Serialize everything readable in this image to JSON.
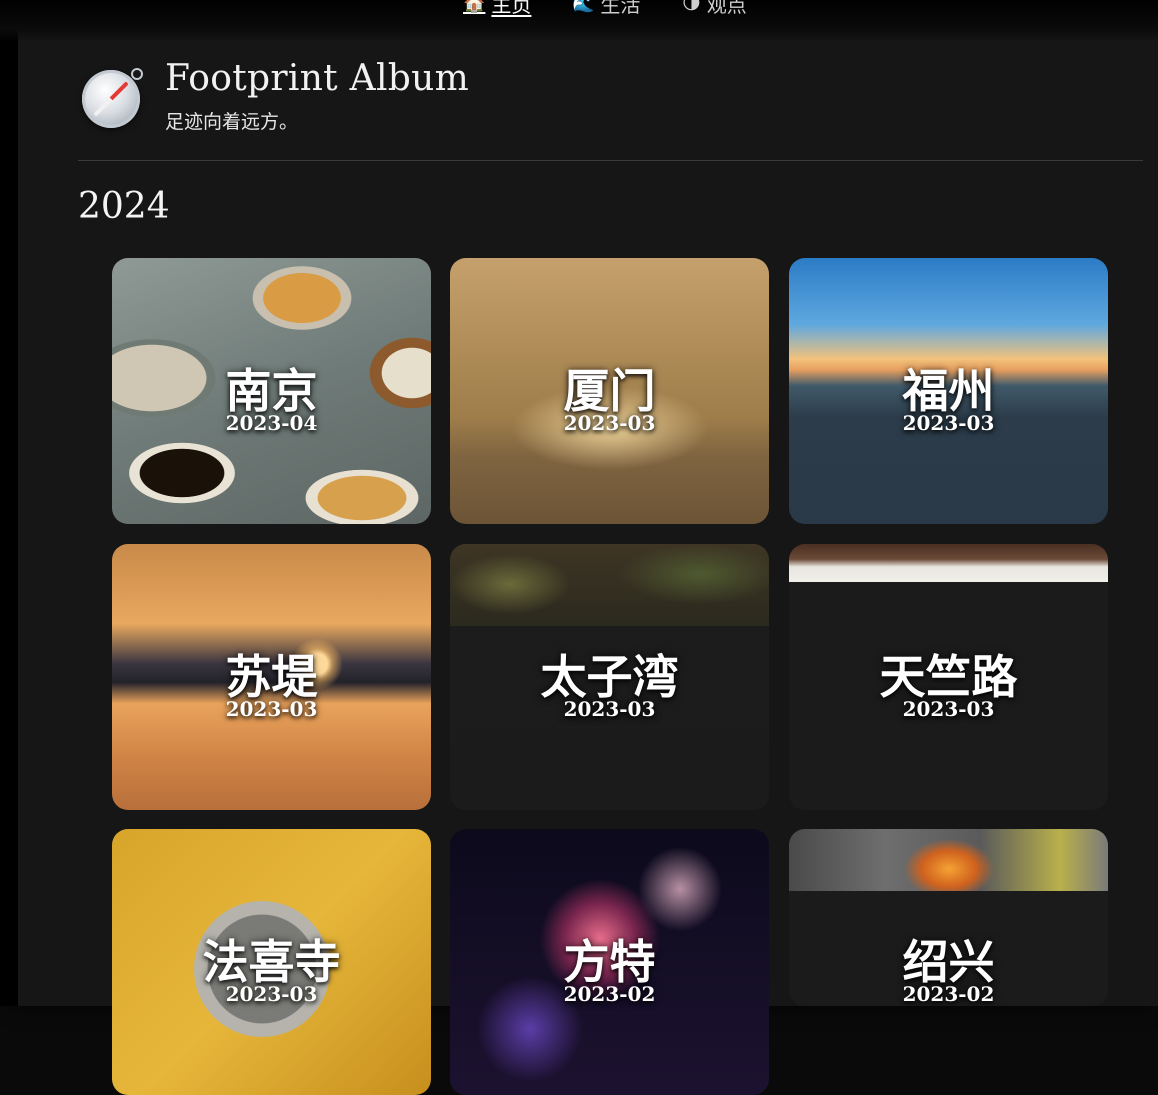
{
  "nav": {
    "items": [
      {
        "icon": "🏠",
        "label": "主页",
        "active": true
      },
      {
        "icon": "🌊",
        "label": "生活",
        "active": false
      },
      {
        "icon": "🌗",
        "label": "观点",
        "active": false
      }
    ]
  },
  "header": {
    "icon": "compass-icon",
    "title": "Footprint Album",
    "subtitle": "足迹向着远方。"
  },
  "section": {
    "year": "2024"
  },
  "cards": [
    {
      "title": "南京",
      "date": "2023-04"
    },
    {
      "title": "厦门",
      "date": "2023-03"
    },
    {
      "title": "福州",
      "date": "2023-03"
    },
    {
      "title": "苏堤",
      "date": "2023-03"
    },
    {
      "title": "太子湾",
      "date": "2023-03"
    },
    {
      "title": "天竺路",
      "date": "2023-03"
    },
    {
      "title": "法喜寺",
      "date": "2023-03"
    },
    {
      "title": "方特",
      "date": "2023-02"
    },
    {
      "title": "绍兴",
      "date": "2023-02"
    }
  ]
}
